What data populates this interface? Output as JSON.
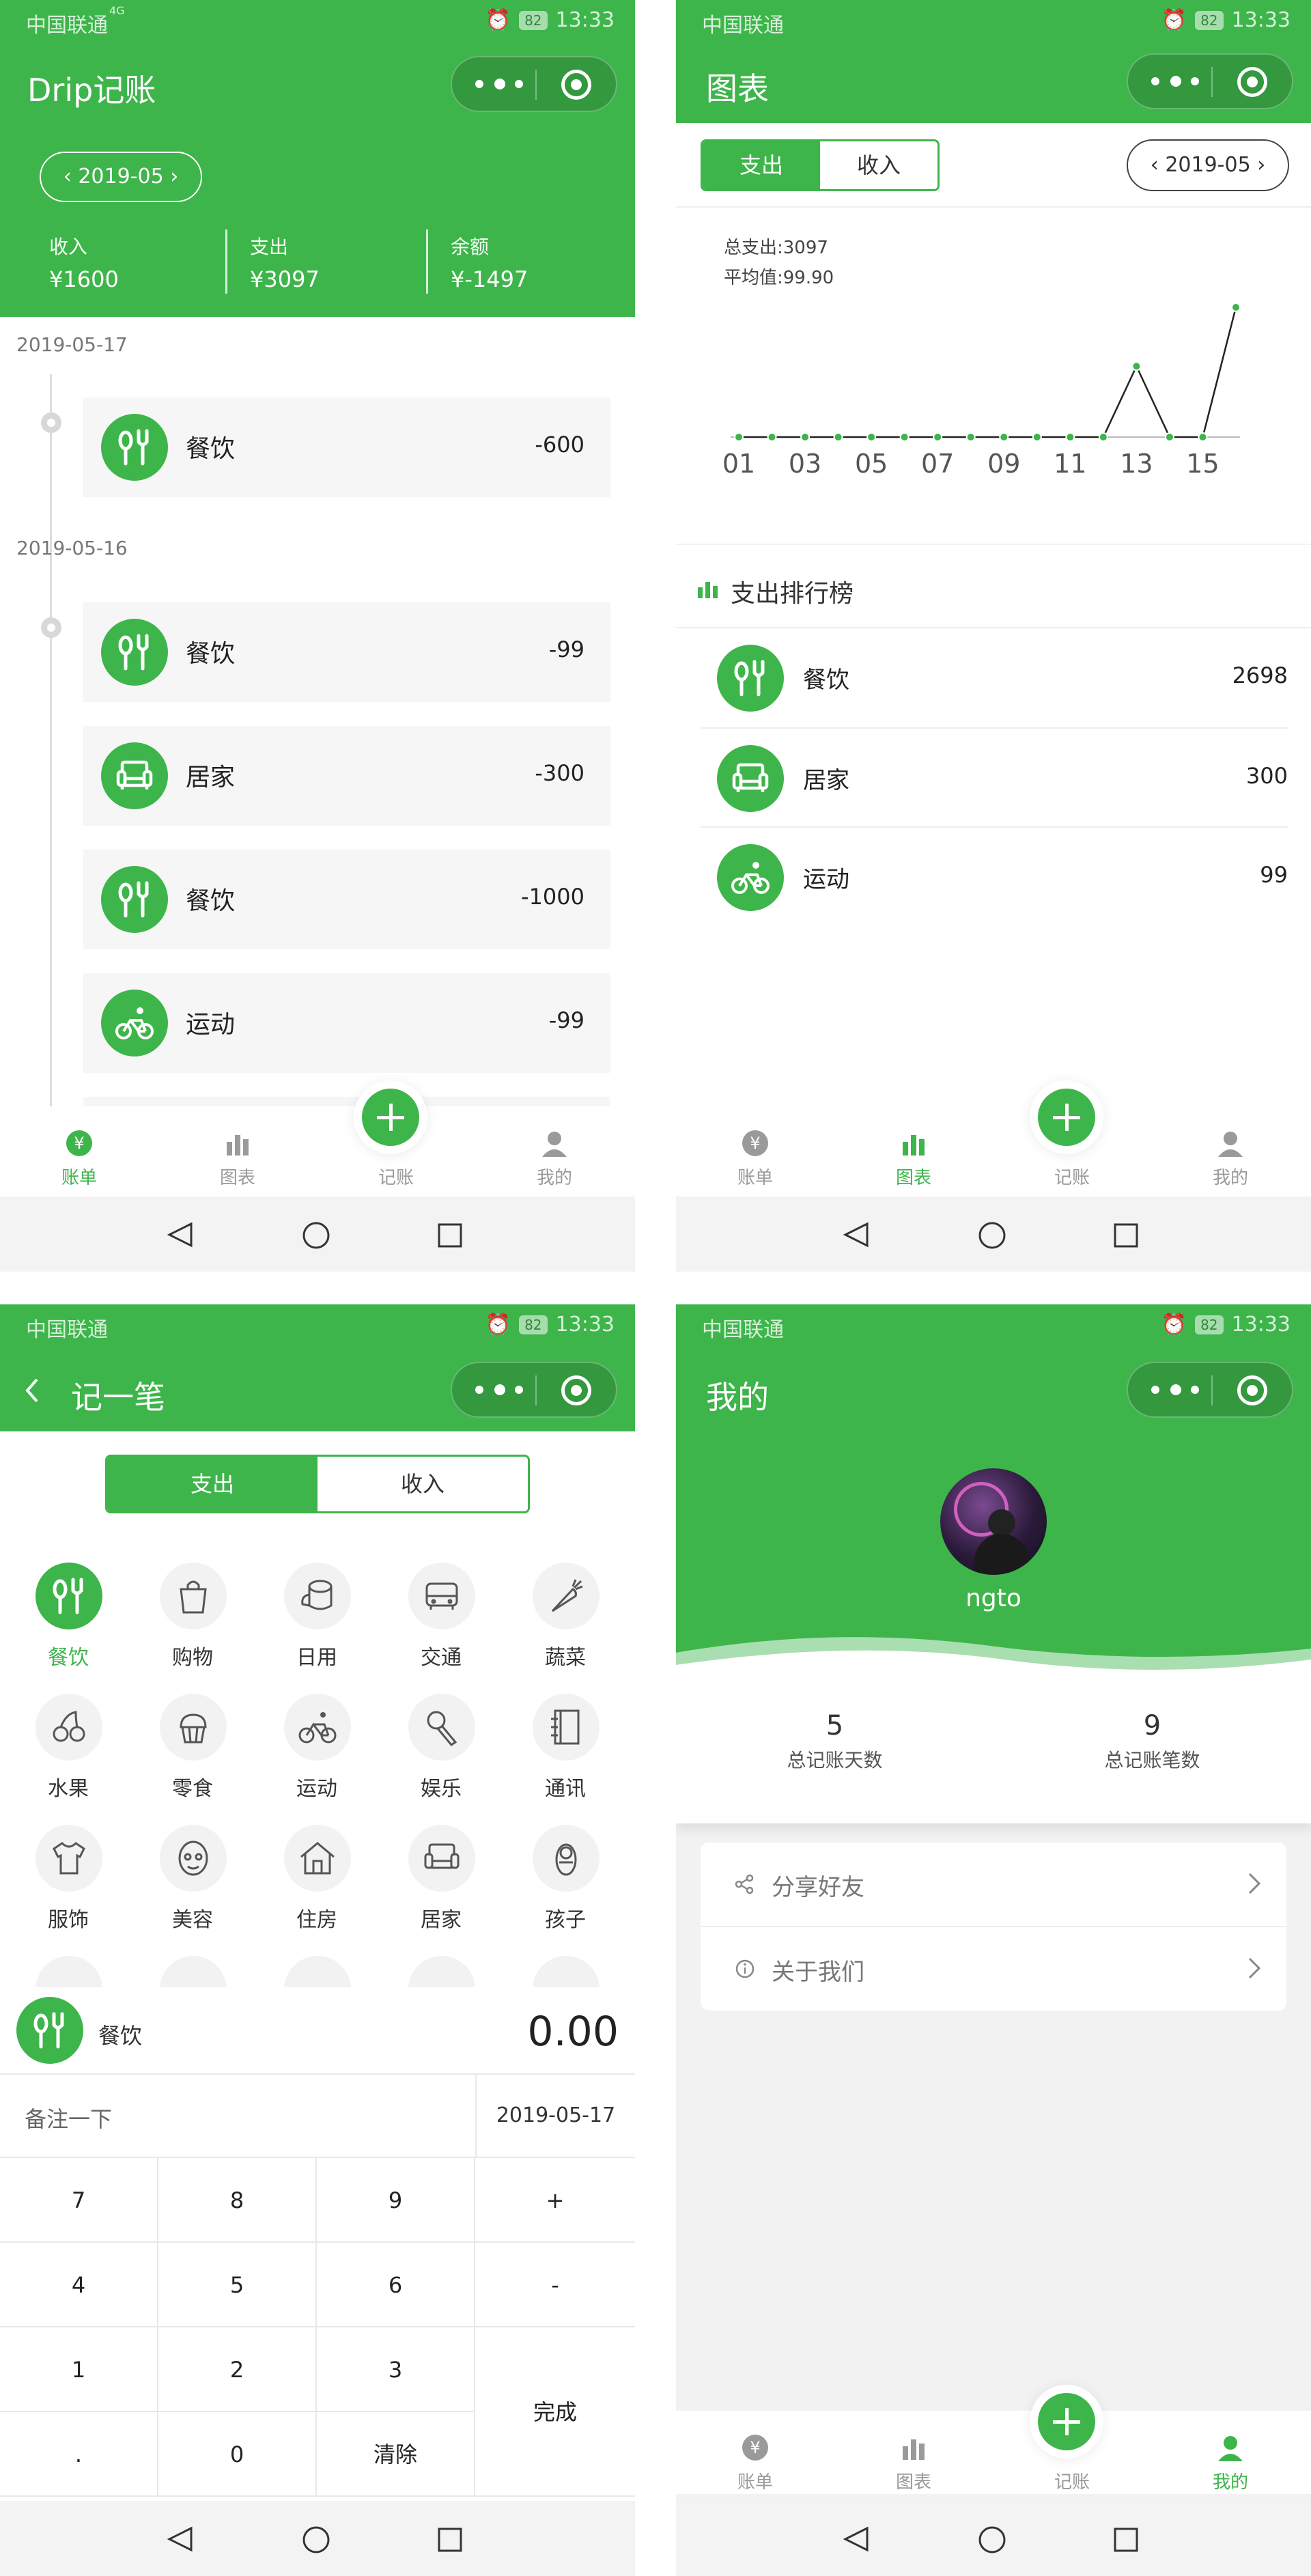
{
  "status": {
    "carrier": "中国联通",
    "network": "4G",
    "battery": "82",
    "time": "13:33"
  },
  "tabs": [
    "账单",
    "图表",
    "记账",
    "我的"
  ],
  "page1": {
    "title": "Drip记账",
    "month": "2019-05",
    "summary": [
      {
        "label": "收入",
        "value": "¥1600"
      },
      {
        "label": "支出",
        "value": "¥3097"
      },
      {
        "label": "余额",
        "value": "¥-1497"
      }
    ],
    "groups": [
      {
        "date": "2019-05-17",
        "records": [
          {
            "icon": "utensils-icon",
            "name": "餐饮",
            "amount": "-600"
          }
        ]
      },
      {
        "date": "2019-05-16",
        "records": [
          {
            "icon": "utensils-icon",
            "name": "餐饮",
            "amount": "-99"
          },
          {
            "icon": "sofa-icon",
            "name": "居家",
            "amount": "-300"
          },
          {
            "icon": "utensils-icon",
            "name": "餐饮",
            "amount": "-1000"
          },
          {
            "icon": "bicycle-icon",
            "name": "运动",
            "amount": "-99"
          }
        ]
      }
    ]
  },
  "page2": {
    "title": "图表",
    "segments": [
      "支出",
      "收入"
    ],
    "month": "2019-05",
    "total_label": "总支出:3097",
    "avg_label": "平均值:99.90",
    "rank_title": "支出排行榜",
    "ranking": [
      {
        "icon": "utensils-icon",
        "name": "餐饮",
        "amount": "2698"
      },
      {
        "icon": "sofa-icon",
        "name": "居家",
        "amount": "300"
      },
      {
        "icon": "bicycle-icon",
        "name": "运动",
        "amount": "99"
      }
    ]
  },
  "chart_data": {
    "type": "line",
    "x": [
      "01",
      "02",
      "03",
      "04",
      "05",
      "06",
      "07",
      "08",
      "09",
      "10",
      "11",
      "12",
      "13",
      "14",
      "15",
      "16"
    ],
    "tick_labels": [
      "01",
      "03",
      "05",
      "07",
      "09",
      "11",
      "13",
      "15"
    ],
    "values": [
      0,
      0,
      0,
      0,
      0,
      0,
      0,
      0,
      0,
      0,
      0,
      0,
      600,
      0,
      0,
      1099
    ],
    "color": "#3db54a",
    "line_color": "#222222",
    "ylim": [
      0,
      1099
    ],
    "grid": false
  },
  "page3": {
    "title": "记一笔",
    "segments": [
      "支出",
      "收入"
    ],
    "categories": [
      {
        "icon": "utensils-icon",
        "label": "餐饮",
        "selected": true
      },
      {
        "icon": "bag-icon",
        "label": "购物"
      },
      {
        "icon": "tissue-icon",
        "label": "日用"
      },
      {
        "icon": "bus-icon",
        "label": "交通"
      },
      {
        "icon": "carrot-icon",
        "label": "蔬菜"
      },
      {
        "icon": "cherry-icon",
        "label": "水果"
      },
      {
        "icon": "cupcake-icon",
        "label": "零食"
      },
      {
        "icon": "bicycle-icon",
        "label": "运动"
      },
      {
        "icon": "microphone-icon",
        "label": "娱乐"
      },
      {
        "icon": "notebook-icon",
        "label": "通讯"
      },
      {
        "icon": "tshirt-icon",
        "label": "服饰"
      },
      {
        "icon": "face-icon",
        "label": "美容"
      },
      {
        "icon": "house-icon",
        "label": "住房"
      },
      {
        "icon": "sofa-icon",
        "label": "居家"
      },
      {
        "icon": "baby-icon",
        "label": "孩子"
      }
    ],
    "selected_name": "餐饮",
    "amount": "0.00",
    "note_placeholder": "备注一下",
    "date": "2019-05-17",
    "keys": [
      "7",
      "8",
      "9",
      "+",
      "4",
      "5",
      "6",
      "-",
      "1",
      "2",
      "3",
      "完成",
      ".",
      "0",
      "清除"
    ]
  },
  "page4": {
    "title": "我的",
    "username": "ngto",
    "stats": [
      {
        "value": "5",
        "label": "总记账天数"
      },
      {
        "value": "9",
        "label": "总记账笔数"
      }
    ],
    "menu": [
      {
        "icon": "share-icon",
        "label": "分享好友"
      },
      {
        "icon": "info-icon",
        "label": "关于我们"
      }
    ]
  }
}
